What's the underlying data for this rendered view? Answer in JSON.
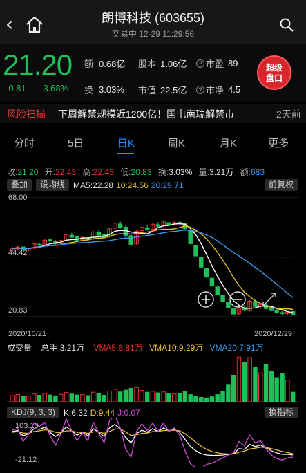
{
  "header": {
    "title": "朗博科技 (603655)",
    "subtitle": "交易中 12-29 11:29:56"
  },
  "quote": {
    "price": "21.20",
    "change": "-0.81",
    "change_pct": "-3.68%",
    "amount_label": "额",
    "amount_value": "0.68亿",
    "equity_label": "股本",
    "equity_value": "1.06亿",
    "pe_label": "市盈",
    "pe_value": "89",
    "turnover_label": "换",
    "turnover_value": "3.03%",
    "mktcap_label": "市值",
    "mktcap_value": "22.5亿",
    "pb_label": "市净",
    "pb_value": "4.5",
    "super_line1": "超级",
    "super_line2": "盘口"
  },
  "risk": {
    "label": "风险扫描",
    "text": "下周解禁规模近1200亿！国电南瑞解禁市",
    "time": "2天前"
  },
  "tabs": [
    {
      "label": "分时"
    },
    {
      "label": "5日"
    },
    {
      "label": "日K"
    },
    {
      "label": "周K"
    },
    {
      "label": "月K"
    },
    {
      "label": "更多"
    }
  ],
  "ohlc": {
    "close_label": "收:",
    "close": "21.20",
    "open_label": "开:",
    "open": "22.43",
    "high_label": "高:",
    "high": "22.43",
    "low_label": "低:",
    "low": "20.83",
    "turn_label": "换:",
    "turn": "3.03%",
    "vol_label": "量:",
    "vol": "3.21万",
    "amt_label": "额:",
    "amt": "683"
  },
  "controls": {
    "stack_btn": "叠加",
    "drawline_btn": "设均线",
    "ma5_label": "MA5:",
    "ma5": "22.28",
    "ma10_label": "10:",
    "ma10": "24.56",
    "ma20_label": "20:",
    "ma20": "29.71",
    "adjust_btn": "前复权"
  },
  "kchart_axis": {
    "top": "68.00",
    "mid": "44.42",
    "low": "20.83",
    "date_start": "2020/10/21",
    "date_end": "2020/12/29"
  },
  "volume": {
    "title": "成交量",
    "total_label": "总手",
    "total": "3.21万",
    "vma5_label": "VMA5:",
    "vma5": "6.81万",
    "vma10_label": "VMA10:",
    "vma10": "9.29万",
    "vma20_label": "VMA20:",
    "vma20": "7.91万"
  },
  "kdj": {
    "title": "KDJ(9, 3, 3)",
    "k_label": "K:",
    "k": "6.32",
    "d_label": "D:",
    "d": "9.44",
    "j_label": "J:",
    "j": "0.07",
    "switch_btn": "换指标",
    "top": "103.13",
    "bottom": "-21.12"
  },
  "colors": {
    "up": "#e93030",
    "down": "#1fc05a",
    "accent": "#2f8fff",
    "ma5": "#ffffff",
    "ma10": "#e8c030",
    "ma20": "#3a9af0"
  },
  "chart_data": {
    "type": "candlestick",
    "x_range": [
      "2020/10/21",
      "2020/12/29"
    ],
    "ylim": [
      20.83,
      68.0
    ],
    "candles": [
      {
        "o": 47.0,
        "h": 48.5,
        "l": 46.2,
        "c": 47.6
      },
      {
        "o": 47.5,
        "h": 49.0,
        "l": 47.0,
        "c": 48.2
      },
      {
        "o": 48.3,
        "h": 48.9,
        "l": 46.8,
        "c": 47.2
      },
      {
        "o": 47.0,
        "h": 48.0,
        "l": 46.5,
        "c": 47.7
      },
      {
        "o": 47.8,
        "h": 50.0,
        "l": 47.5,
        "c": 49.6
      },
      {
        "o": 49.4,
        "h": 50.2,
        "l": 48.6,
        "c": 49.0
      },
      {
        "o": 49.1,
        "h": 51.5,
        "l": 48.8,
        "c": 51.0
      },
      {
        "o": 51.2,
        "h": 52.0,
        "l": 50.2,
        "c": 50.6
      },
      {
        "o": 50.5,
        "h": 51.0,
        "l": 49.0,
        "c": 49.5
      },
      {
        "o": 49.6,
        "h": 51.3,
        "l": 49.2,
        "c": 50.9
      },
      {
        "o": 51.0,
        "h": 53.5,
        "l": 50.8,
        "c": 53.1
      },
      {
        "o": 53.0,
        "h": 54.0,
        "l": 51.9,
        "c": 52.2
      },
      {
        "o": 52.4,
        "h": 53.0,
        "l": 50.5,
        "c": 51.0
      },
      {
        "o": 51.2,
        "h": 52.5,
        "l": 50.8,
        "c": 52.1
      },
      {
        "o": 52.0,
        "h": 52.8,
        "l": 50.6,
        "c": 51.3
      },
      {
        "o": 51.5,
        "h": 54.8,
        "l": 51.2,
        "c": 54.3
      },
      {
        "o": 54.2,
        "h": 55.0,
        "l": 52.6,
        "c": 53.0
      },
      {
        "o": 53.2,
        "h": 54.0,
        "l": 51.6,
        "c": 52.2
      },
      {
        "o": 52.5,
        "h": 56.0,
        "l": 52.0,
        "c": 55.6
      },
      {
        "o": 55.8,
        "h": 58.3,
        "l": 55.0,
        "c": 57.8
      },
      {
        "o": 57.5,
        "h": 58.5,
        "l": 55.6,
        "c": 56.0
      },
      {
        "o": 56.2,
        "h": 57.0,
        "l": 52.0,
        "c": 52.6
      },
      {
        "o": 52.8,
        "h": 54.0,
        "l": 48.6,
        "c": 49.2
      },
      {
        "o": 49.6,
        "h": 55.0,
        "l": 49.2,
        "c": 54.6
      },
      {
        "o": 54.8,
        "h": 56.8,
        "l": 54.0,
        "c": 56.2
      },
      {
        "o": 56.0,
        "h": 57.3,
        "l": 54.8,
        "c": 55.2
      },
      {
        "o": 55.4,
        "h": 58.0,
        "l": 55.0,
        "c": 57.4
      },
      {
        "o": 57.2,
        "h": 58.3,
        "l": 56.0,
        "c": 56.6
      },
      {
        "o": 56.8,
        "h": 59.0,
        "l": 56.3,
        "c": 58.3
      },
      {
        "o": 58.0,
        "h": 58.8,
        "l": 56.6,
        "c": 57.2
      },
      {
        "o": 57.4,
        "h": 58.6,
        "l": 56.8,
        "c": 58.0
      },
      {
        "o": 58.2,
        "h": 59.0,
        "l": 57.0,
        "c": 57.8
      },
      {
        "o": 57.6,
        "h": 58.0,
        "l": 55.0,
        "c": 55.6
      },
      {
        "o": 55.0,
        "h": 55.2,
        "l": 49.5,
        "c": 49.6
      },
      {
        "o": 49.0,
        "h": 49.0,
        "l": 44.7,
        "c": 44.7
      },
      {
        "o": 44.2,
        "h": 44.2,
        "l": 40.2,
        "c": 40.2
      },
      {
        "o": 39.8,
        "h": 39.8,
        "l": 36.2,
        "c": 36.2
      },
      {
        "o": 35.8,
        "h": 35.8,
        "l": 32.6,
        "c": 32.6
      },
      {
        "o": 32.3,
        "h": 32.3,
        "l": 29.3,
        "c": 29.3
      },
      {
        "o": 29.0,
        "h": 29.0,
        "l": 26.4,
        "c": 26.4
      },
      {
        "o": 26.2,
        "h": 26.2,
        "l": 23.8,
        "c": 23.8
      },
      {
        "o": 23.5,
        "h": 23.5,
        "l": 21.4,
        "c": 21.4
      },
      {
        "o": 21.5,
        "h": 24.6,
        "l": 21.2,
        "c": 23.9
      },
      {
        "o": 24.0,
        "h": 25.0,
        "l": 22.5,
        "c": 22.9
      },
      {
        "o": 22.8,
        "h": 27.0,
        "l": 22.4,
        "c": 26.6
      },
      {
        "o": 26.5,
        "h": 27.2,
        "l": 24.0,
        "c": 24.4
      },
      {
        "o": 24.5,
        "h": 25.6,
        "l": 23.6,
        "c": 25.2
      },
      {
        "o": 25.0,
        "h": 25.5,
        "l": 23.2,
        "c": 23.6
      },
      {
        "o": 23.5,
        "h": 24.2,
        "l": 22.4,
        "c": 22.8
      },
      {
        "o": 22.9,
        "h": 23.4,
        "l": 21.8,
        "c": 22.0
      },
      {
        "o": 22.0,
        "h": 22.6,
        "l": 21.2,
        "c": 21.6
      },
      {
        "o": 21.6,
        "h": 22.4,
        "l": 20.9,
        "c": 22.1
      },
      {
        "o": 22.43,
        "h": 22.43,
        "l": 20.83,
        "c": 21.2
      }
    ],
    "volume": [
      2.1,
      2.4,
      1.8,
      1.9,
      2.6,
      2.2,
      2.8,
      2.3,
      2.0,
      2.5,
      3.1,
      2.6,
      2.3,
      2.4,
      2.1,
      3.2,
      2.7,
      2.2,
      3.6,
      4.2,
      3.3,
      3.9,
      4.5,
      4.8,
      3.8,
      3.2,
      3.5,
      3.0,
      3.3,
      2.8,
      2.6,
      2.9,
      3.5,
      2.4,
      1.8,
      1.5,
      1.3,
      1.7,
      2.4,
      3.4,
      5.6,
      8.9,
      15.0,
      13.2,
      14.8,
      11.6,
      9.7,
      12.4,
      10.2,
      8.1,
      9.6,
      7.2,
      3.21
    ],
    "kdj_k": [
      72,
      75,
      60,
      66,
      80,
      78,
      84,
      70,
      58,
      68,
      85,
      74,
      62,
      70,
      60,
      80,
      70,
      58,
      82,
      92,
      80,
      55,
      40,
      66,
      76,
      70,
      80,
      72,
      82,
      74,
      78,
      70,
      50,
      30,
      18,
      10,
      6,
      5,
      5,
      6,
      8,
      10,
      24,
      22,
      36,
      30,
      34,
      26,
      18,
      12,
      8,
      8,
      6.32
    ],
    "kdj_d": [
      70,
      72,
      68,
      67,
      72,
      74,
      77,
      75,
      70,
      69,
      74,
      74,
      70,
      70,
      67,
      71,
      71,
      67,
      72,
      79,
      79,
      71,
      61,
      63,
      67,
      68,
      72,
      72,
      75,
      75,
      76,
      74,
      66,
      54,
      42,
      31,
      22,
      16,
      12,
      10,
      9,
      9,
      14,
      17,
      23,
      25,
      28,
      27,
      24,
      20,
      16,
      13,
      9.44
    ],
    "kdj_j": [
      76,
      81,
      44,
      64,
      96,
      86,
      98,
      60,
      34,
      66,
      107,
      74,
      46,
      70,
      46,
      98,
      68,
      40,
      102,
      118,
      82,
      23,
      0,
      72,
      94,
      74,
      96,
      72,
      96,
      72,
      82,
      62,
      18,
      -18,
      -30,
      -32,
      -20,
      -17,
      -9,
      -2,
      6,
      12,
      44,
      32,
      62,
      40,
      46,
      24,
      6,
      -4,
      -8,
      -2,
      0.07
    ]
  }
}
